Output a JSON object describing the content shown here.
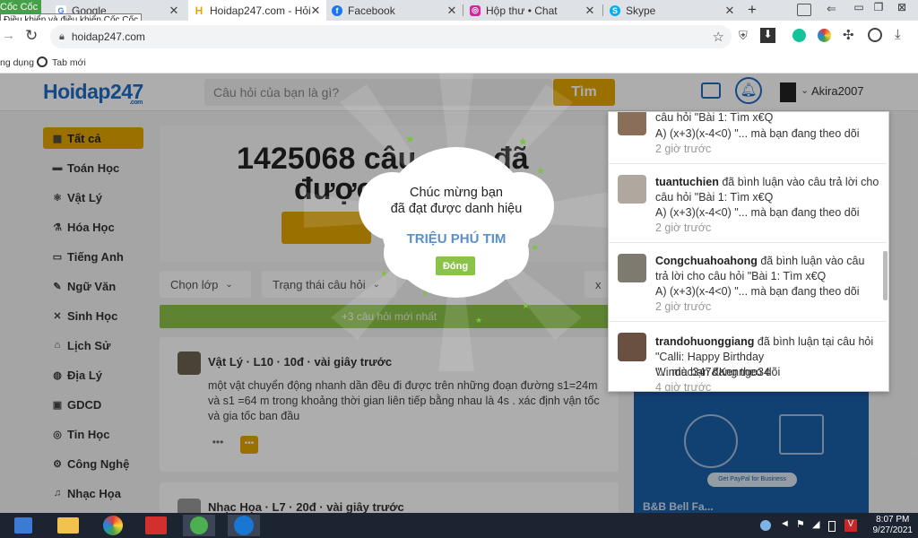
{
  "browser": {
    "coccoc_tab": "Cốc Cốc",
    "tooltip": "Điều khiển và điều khiển Cốc Cốc",
    "tabs": [
      {
        "label": "Google",
        "icon": "google-icon"
      },
      {
        "label": "Hoidap247.com - Hỏi",
        "icon": "hoidap-icon"
      },
      {
        "label": "Facebook",
        "icon": "facebook-icon"
      },
      {
        "label": "Hộp thư • Chat",
        "icon": "instagram-icon"
      },
      {
        "label": "Skype",
        "icon": "skype-icon"
      }
    ],
    "new_tab": "+",
    "url": "hoidap247.com",
    "bookmarks": [
      "ng dụng",
      "Tab mới"
    ]
  },
  "site": {
    "logo": "Hoidap247",
    "logo_sub": ".com",
    "search_placeholder": "Câu hỏi của bạn là gì?",
    "search_button": "Tìm",
    "username": "Akira2007"
  },
  "sidebar": {
    "items": [
      {
        "label": "Tất cả",
        "icon": "grid-icon",
        "glyph": "▦"
      },
      {
        "label": "Toán Học",
        "icon": "math-icon",
        "glyph": "▬"
      },
      {
        "label": "Vật Lý",
        "icon": "atom-icon",
        "glyph": "⚛"
      },
      {
        "label": "Hóa Học",
        "icon": "flask-icon",
        "glyph": "⚗"
      },
      {
        "label": "Tiếng Anh",
        "icon": "english-icon",
        "glyph": "▭"
      },
      {
        "label": "Ngữ Văn",
        "icon": "pen-icon",
        "glyph": "✎"
      },
      {
        "label": "Sinh Học",
        "icon": "dna-icon",
        "glyph": "✕"
      },
      {
        "label": "Lịch Sử",
        "icon": "history-icon",
        "glyph": "⌂"
      },
      {
        "label": "Địa Lý",
        "icon": "globe-icon",
        "glyph": "◍"
      },
      {
        "label": "GDCD",
        "icon": "civic-icon",
        "glyph": "▣"
      },
      {
        "label": "Tin Học",
        "icon": "computer-icon",
        "glyph": "◎"
      },
      {
        "label": "Công Nghệ",
        "icon": "tech-icon",
        "glyph": "⚙"
      },
      {
        "label": "Nhạc Họa",
        "icon": "music-icon",
        "glyph": "♫"
      }
    ]
  },
  "banner": {
    "count_line1": "1425068 câu",
    "suffix1": "đã",
    "count_line2": "được"
  },
  "filters": {
    "grade": "Chọn lớp",
    "status": "Trạng thái câu hỏi",
    "extra": "x"
  },
  "new_questions": "+3 câu hỏi mới nhất",
  "questions": [
    {
      "meta": "Vật Lý  ·  L10  ·  10đ  ·  vài giây trước",
      "text": "một vật chuyển động nhanh dần đều đi được trên những đoạn đường s1=24m và s1 =64 m trong  khoảng thời gian liên tiếp bằng nhau là 4s . xác định vận tốc và gia tốc ban đầu"
    },
    {
      "meta": "Nhạc Họa  ·  L7  ·  20đ  ·  vài giây trước",
      "text": ""
    }
  ],
  "notifications": [
    {
      "user": "",
      "text": "câu hỏi \"Bài 1: Tìm x€Q",
      "detail": "A) (x+3)(x-4<0) \"... mà bạn đang theo dõi",
      "time": "2 giờ trước"
    },
    {
      "user": "tuantuchien",
      "text": " đã bình luận vào câu trả lời cho câu hỏi \"Bài 1: Tìm x€Q",
      "detail": "A) (x+3)(x-4<0) \"... mà bạn đang theo dõi",
      "time": "2 giờ trước"
    },
    {
      "user": "Congchuahoahong",
      "text": " đã bình luận vào câu trả lời cho câu hỏi \"Bài 1: Tìm x€Q",
      "detail": "A) (x+3)(x-4<0) \"... mà bạn đang theo dõi",
      "time": "2 giờ trước"
    },
    {
      "user": "trandohuonggiang",
      "text": " đã bình luận tại câu hỏi \"Calli: Happy Birthday Winduc347&Kenngo34",
      "detail": "\"... mà bạn đang theo dõi",
      "time": "4 giờ trước"
    }
  ],
  "popup": {
    "line1": "Chúc mừng bạn",
    "line2": "đã đạt được danh hiệu",
    "badge": "TRIỆU PHÚ TIM",
    "close": "Đóng"
  },
  "ad": {
    "cta": "Get PayPal for Business",
    "bottom": "B&B Bell Fa..."
  },
  "taskbar": {
    "time": "8:07 PM",
    "date": "9/27/2021",
    "apps": [
      "media-icon",
      "explorer-icon",
      "coccoc-icon",
      "paint-icon",
      "app-icon",
      "zalo-icon"
    ]
  },
  "colors": {
    "accent": "#e4a600",
    "green": "#8bc34a",
    "brand_blue": "#1e6cc4"
  }
}
